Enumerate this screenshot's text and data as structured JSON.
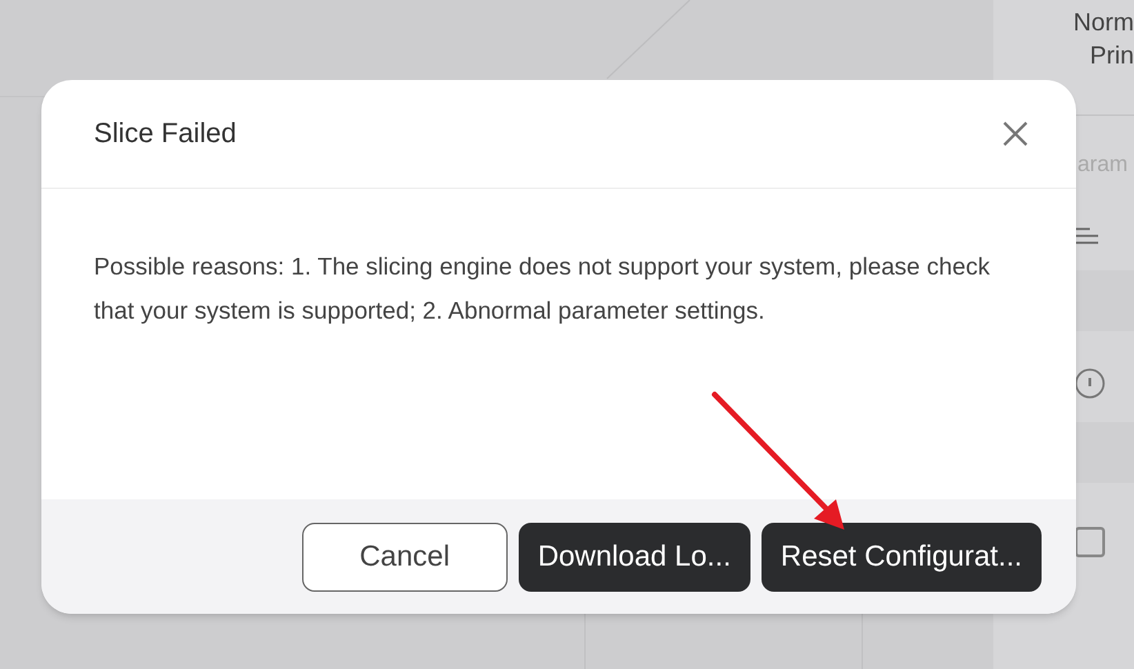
{
  "background": {
    "print_mode": [
      "Norm",
      "Prin"
    ],
    "section_label": "aram",
    "checkbox": {
      "checked": false
    }
  },
  "dialog": {
    "title": "Slice Failed",
    "message": "Possible reasons: 1. The slicing engine does not support your system, please check that your system is supported; 2. Abnormal parameter settings.",
    "buttons": [
      {
        "label": "Cancel",
        "kind": "secondary"
      },
      {
        "label": "Download Lo...",
        "kind": "primary"
      },
      {
        "label": "Reset Configurat...",
        "kind": "primary"
      }
    ]
  }
}
